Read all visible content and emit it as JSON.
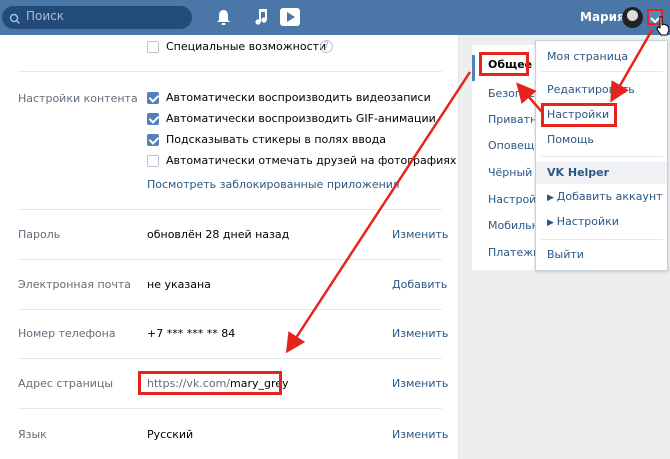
{
  "topbar": {
    "search_placeholder": "Поиск",
    "user_name": "Мария"
  },
  "main": {
    "special_features": "Специальные возможности",
    "content_settings_label": "Настройки контента",
    "checkboxes": [
      {
        "label": "Автоматически воспроизводить видеозаписи",
        "checked": true
      },
      {
        "label": "Автоматически воспроизводить GIF-анимации",
        "checked": true
      },
      {
        "label": "Подсказывать стикеры в полях ввода",
        "checked": true
      },
      {
        "label": "Автоматически отмечать друзей на фотографиях",
        "checked": false
      }
    ],
    "blocked_apps_link": "Посмотреть заблокированные приложения",
    "rows": [
      {
        "label": "Пароль",
        "value": "обновлён 28 дней назад",
        "action": "Изменить"
      },
      {
        "label": "Электронная почта",
        "value": "не указана",
        "action": "Добавить"
      },
      {
        "label": "Номер телефона",
        "value": "+7 *** *** ** 84",
        "action": "Изменить"
      },
      {
        "label": "Адрес страницы",
        "value_prefix": "https://vk.com/",
        "value_name": "mary_grey",
        "action": "Изменить"
      },
      {
        "label": "Язык",
        "value": "Русский",
        "action": "Изменить"
      }
    ]
  },
  "side_menu": {
    "active": "Общее",
    "items": [
      "Безопасность",
      "Приватность",
      "Оповещения",
      "Чёрный список",
      "Настройки приложений",
      "Мобильные сервисы",
      "Платежи и переводы"
    ]
  },
  "dropdown": {
    "items": [
      "Моя страница",
      "Редактировать",
      "Настройки",
      "Помощь"
    ],
    "section_title": "VK Helper",
    "helper_items": [
      "Добавить аккаунт",
      "Настройки"
    ],
    "logout": "Выйти"
  },
  "colors": {
    "topbar": "#4a76a8",
    "accent": "#5181b8",
    "link": "#2a5885",
    "highlight": "#e5241d"
  }
}
